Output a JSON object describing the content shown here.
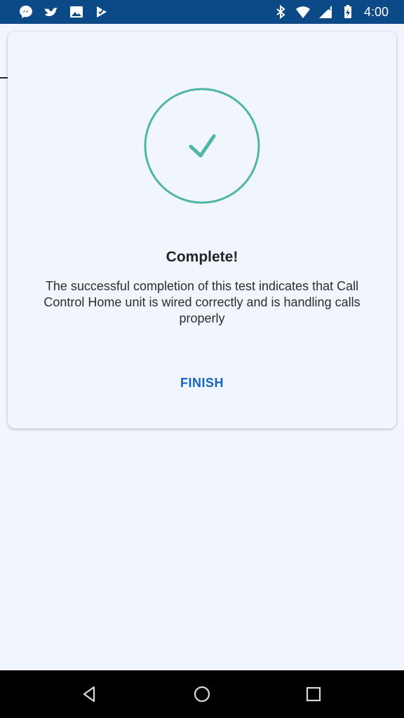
{
  "status_bar": {
    "time": "4:00",
    "left_icons": [
      "messenger-icon",
      "bird-icon",
      "image-icon",
      "check-app-icon"
    ],
    "right_icons": [
      "bluetooth-icon",
      "wifi-icon",
      "cellular-no-signal-icon",
      "battery-charging-icon"
    ]
  },
  "dialog": {
    "title": "Complete!",
    "message": "The successful completion of this test indicates that Call Control Home unit is wired correctly and is handling calls properly",
    "finish_label": "FINISH",
    "icon": "check-circle-icon"
  },
  "nav_bar": {
    "buttons": [
      "back-icon",
      "home-icon",
      "recents-icon"
    ]
  },
  "colors": {
    "status_bar": "#0b4a86",
    "background": "#f1f6fd",
    "accent_teal": "#4db6a6",
    "link_blue": "#1565c0"
  }
}
